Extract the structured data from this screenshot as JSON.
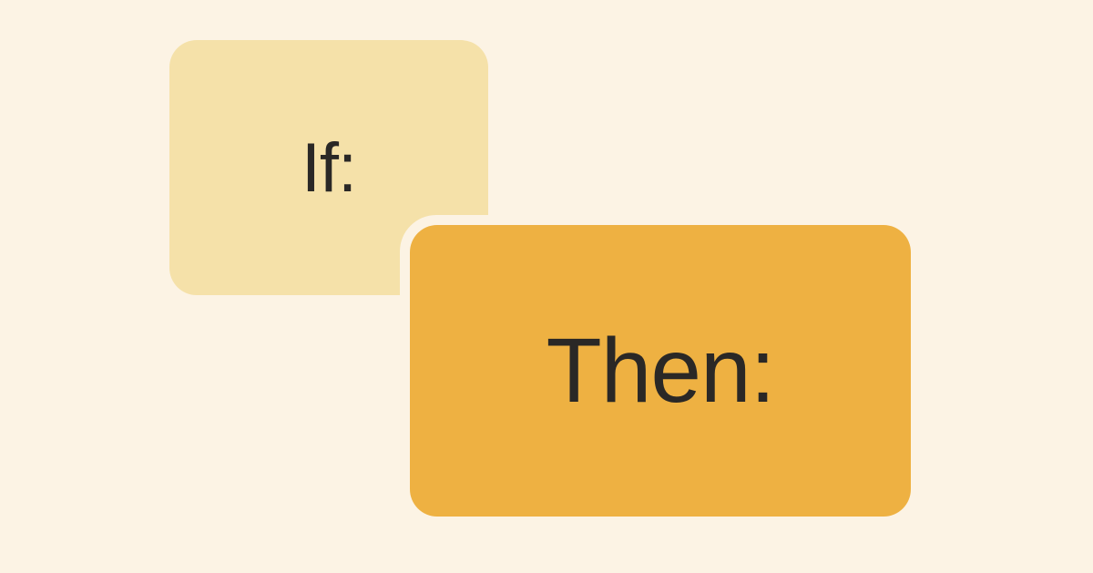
{
  "cards": {
    "if": {
      "label": "If:"
    },
    "then": {
      "label": "Then:"
    }
  }
}
